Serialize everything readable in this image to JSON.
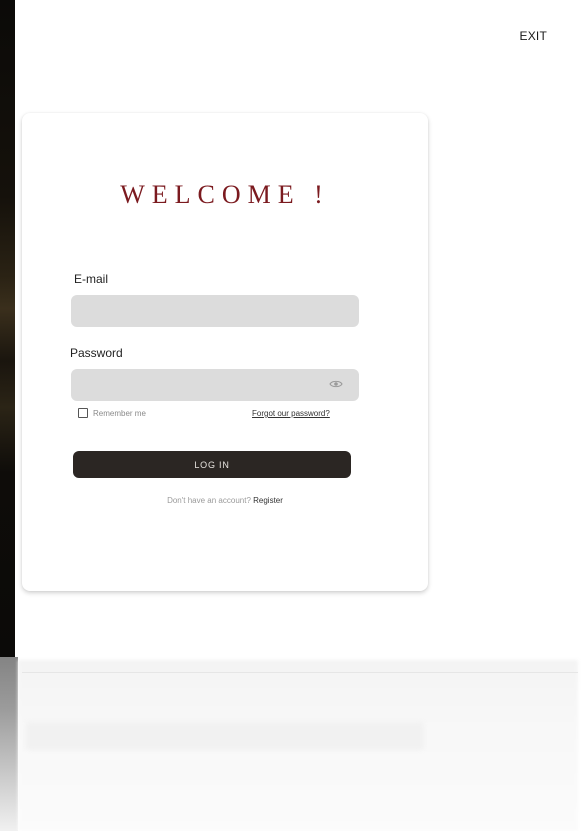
{
  "header": {
    "exit_label": "EXIT"
  },
  "login_card": {
    "title": "WELCOME !",
    "email": {
      "label": "E-mail",
      "value": "",
      "placeholder": ""
    },
    "password": {
      "label": "Password",
      "value": "",
      "placeholder": "",
      "toggle_icon": "eye-icon"
    },
    "remember_me": {
      "label": "Remember me",
      "checked": false
    },
    "forgot_password_label": "Forgot our password?",
    "login_button_label": "LOG IN",
    "register_prompt": "Don't have an account?",
    "register_label": "Register"
  },
  "colors": {
    "title": "#7b1a1f",
    "button_bg": "#2b2623",
    "input_bg": "#dcdcdc",
    "background": "#ffffff"
  }
}
